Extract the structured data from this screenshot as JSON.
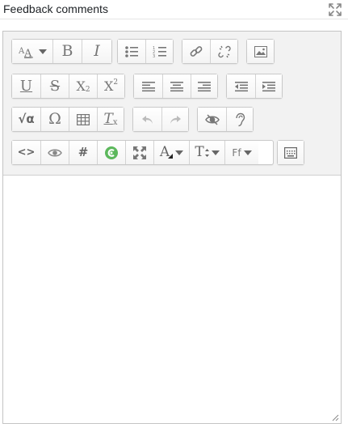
{
  "field": {
    "title": "Feedback comments"
  },
  "icons": {
    "expand": "expand-icon",
    "accent_color": "#5cb85c",
    "icon_color": "#777777"
  },
  "toolbar": {
    "row1": {
      "paragraph_styles": "paragraph-styles",
      "bold": "B",
      "italic": "I",
      "unordered_list": "unordered-list",
      "ordered_list": "ordered-list",
      "link": "link",
      "unlink": "unlink",
      "image": "image"
    },
    "row2": {
      "underline": "U",
      "strikethrough": "S",
      "subscript": "X",
      "subscript_mark": "2",
      "superscript": "X",
      "superscript_mark": "2",
      "align_left": "align-left",
      "align_center": "align-center",
      "align_right": "align-right",
      "outdent": "outdent",
      "indent": "indent"
    },
    "row3": {
      "equation": "√α",
      "special_char": "Ω",
      "table": "table",
      "clear_formatting": "T",
      "clear_formatting_mark": "x",
      "undo": "undo",
      "redo": "redo",
      "accessibility_checker": "accessibility-checker",
      "screen_reader_helper": "screen-reader-helper"
    },
    "row4": {
      "html": "<>",
      "preview": "preview",
      "hashtag": "#",
      "recordrtc": "recordrtc",
      "fullscreen": "fullscreen",
      "font_color": "A",
      "font_size": "T",
      "font_family": "Ff",
      "show_more": "show-more"
    }
  },
  "content": {
    "text": ""
  }
}
